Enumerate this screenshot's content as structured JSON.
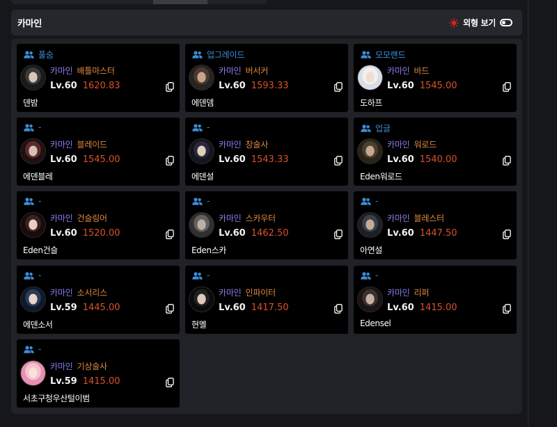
{
  "header": {
    "title": "카마인",
    "toggle_label": "외형 보기",
    "accent_color": "#e02020"
  },
  "cards": [
    {
      "party": "풀숨",
      "server": "카마인",
      "class": "배틀마스터",
      "level": "Lv.60",
      "item_level": "1620.83",
      "name": "덴밤"
    },
    {
      "party": "업그레이드",
      "server": "카마인",
      "class": "버서커",
      "level": "Lv.60",
      "item_level": "1593.33",
      "name": "에덴뎀"
    },
    {
      "party": "모모랜드",
      "server": "카마인",
      "class": "바드",
      "level": "Lv.60",
      "item_level": "1545.00",
      "name": "도하프"
    },
    {
      "party": "-",
      "server": "카마인",
      "class": "블레이드",
      "level": "Lv.60",
      "item_level": "1545.00",
      "name": "에덴블레"
    },
    {
      "party": "-",
      "server": "카마인",
      "class": "창술사",
      "level": "Lv.60",
      "item_level": "1543.33",
      "name": "에덴설"
    },
    {
      "party": "업글",
      "server": "카마인",
      "class": "워로드",
      "level": "Lv.60",
      "item_level": "1540.00",
      "name": "Eden워로드"
    },
    {
      "party": "-",
      "server": "카마인",
      "class": "건슬링어",
      "level": "Lv.60",
      "item_level": "1520.00",
      "name": "Eden건슬"
    },
    {
      "party": "-",
      "server": "카마인",
      "class": "스카우터",
      "level": "Lv.60",
      "item_level": "1462.50",
      "name": "Eden스카"
    },
    {
      "party": "-",
      "server": "카마인",
      "class": "블레스터",
      "level": "Lv.60",
      "item_level": "1447.50",
      "name": "아연설"
    },
    {
      "party": "-",
      "server": "카마인",
      "class": "소서리스",
      "level": "Lv.59",
      "item_level": "1445.00",
      "name": "에덴소서"
    },
    {
      "party": "-",
      "server": "카마인",
      "class": "인파이터",
      "level": "Lv.60",
      "item_level": "1417.50",
      "name": "현멜"
    },
    {
      "party": "-",
      "server": "카마인",
      "class": "리퍼",
      "level": "Lv.60",
      "item_level": "1415.00",
      "name": "Edensel"
    },
    {
      "party": "-",
      "server": "카마인",
      "class": "기상술사",
      "level": "Lv.59",
      "item_level": "1415.00",
      "name": "서초구청우산털이범"
    }
  ],
  "colors": {
    "party": "#3b8fd9",
    "server": "#8f7cf0",
    "class": "#e0883f",
    "item_level": "#d9522a"
  },
  "icons": {
    "party": "users-icon",
    "copy": "copy-icon",
    "toggle": "toggle-icon",
    "accent": "sun-icon"
  }
}
